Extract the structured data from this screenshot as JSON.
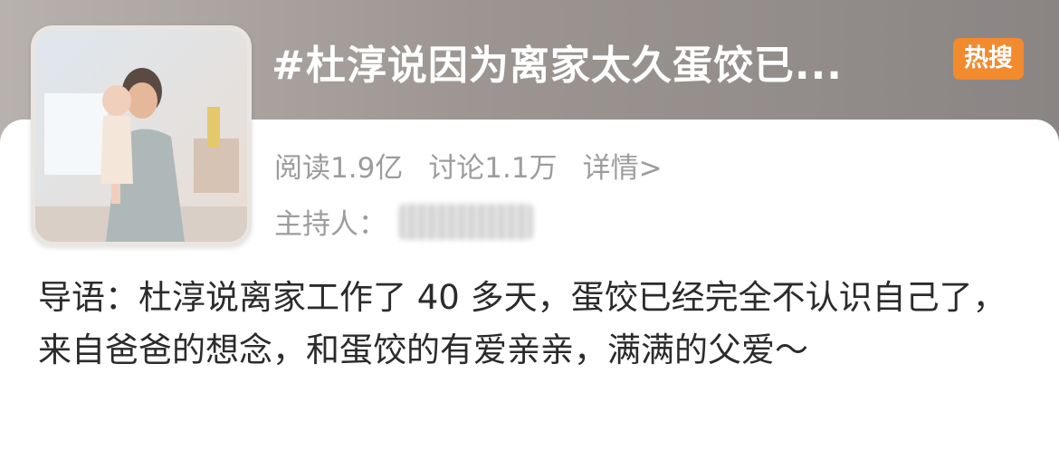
{
  "topic": {
    "title": "#杜淳说因为离家太久蛋饺已...",
    "badge": "热搜",
    "cover_image": "father-kissing-baby-photo"
  },
  "stats": {
    "reads": "阅读1.9亿",
    "discussions": "讨论1.1万",
    "detail_link": "详情>"
  },
  "host": {
    "label": "主持人："
  },
  "intro": {
    "text": "导语：杜淳说离家工作了 40 多天，蛋饺已经完全不认识自己了，来自爸爸的想念，和蛋饺的有爱亲亲，满满的父爱～"
  },
  "colors": {
    "badge": "#f28a2e",
    "stat_text": "#9c9c9c",
    "body_text": "#2b2b2b"
  }
}
